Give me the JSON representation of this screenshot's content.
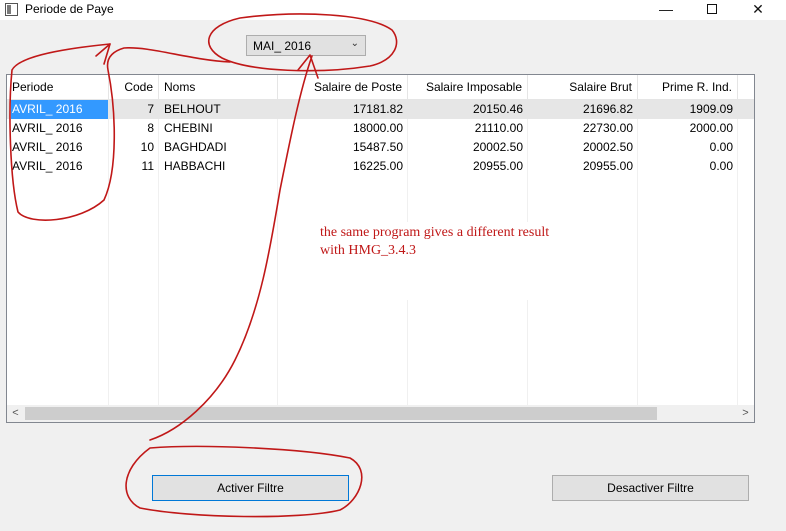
{
  "window": {
    "title": "Periode de Paye",
    "min_glyph": "—",
    "close_glyph": "✕",
    "icon": "app-window-icon"
  },
  "period_combo": {
    "value": "MAI_ 2016",
    "arrow_glyph": "⌄"
  },
  "grid": {
    "columns": [
      "Periode",
      "Code",
      "Noms",
      "Salaire de Poste",
      "Salaire Imposable",
      "Salaire Brut",
      "Prime R. Ind."
    ],
    "rows": [
      [
        "AVRIL_ 2016",
        "7",
        "BELHOUT",
        "17181.82",
        "20150.46",
        "21696.82",
        "1909.09"
      ],
      [
        "AVRIL_ 2016",
        "8",
        "CHEBINI",
        "18000.00",
        "21110.00",
        "22730.00",
        "2000.00"
      ],
      [
        "AVRIL_ 2016",
        "10",
        "BAGHDADI",
        "15487.50",
        "20002.50",
        "20002.50",
        "0.00"
      ],
      [
        "AVRIL_ 2016",
        "11",
        "HABBACHI",
        "16225.00",
        "20955.00",
        "20955.00",
        "0.00"
      ]
    ],
    "scroll_left_glyph": "<",
    "scroll_right_glyph": ">"
  },
  "buttons": {
    "activer": "Activer Filtre",
    "desactiver": "Desactiver Filtre"
  },
  "annotation": {
    "line1": "the same program gives a different result",
    "line2": "with HMG_3.4.3",
    "color": "#c01818"
  }
}
